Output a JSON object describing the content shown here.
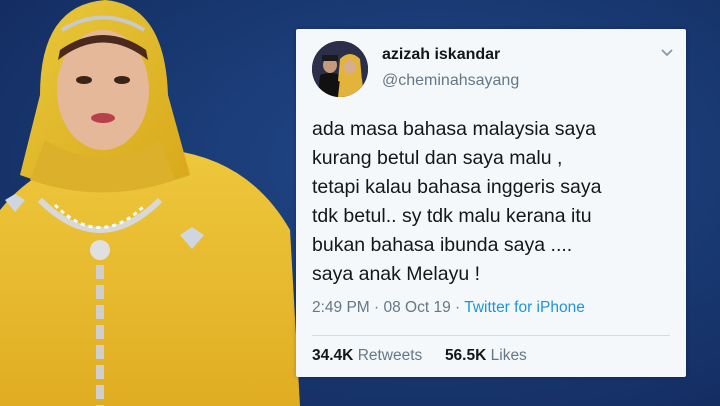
{
  "tweet": {
    "display_name": "azizah iskandar",
    "handle": "@cheminahsayang",
    "text_lines": [
      "ada masa bahasa malaysia saya",
      "kurang betul dan saya malu ,",
      "tetapi kalau bahasa inggeris saya",
      "tdk betul.. sy tdk malu kerana itu",
      "bukan bahasa ibunda saya ....",
      "saya anak Melayu !"
    ],
    "timestamp": "2:49 PM · 08 Oct 19 · ",
    "source": "Twitter for iPhone",
    "retweets_count": "34.4K",
    "retweets_label": "Retweets",
    "likes_count": "56.5K",
    "likes_label": "Likes"
  },
  "colors": {
    "background": "#1a3a73",
    "card": "#f5f8fa",
    "link": "#1b95e0",
    "secondary_text": "#657786"
  },
  "icons": {
    "caret": "chevron-down-icon"
  }
}
